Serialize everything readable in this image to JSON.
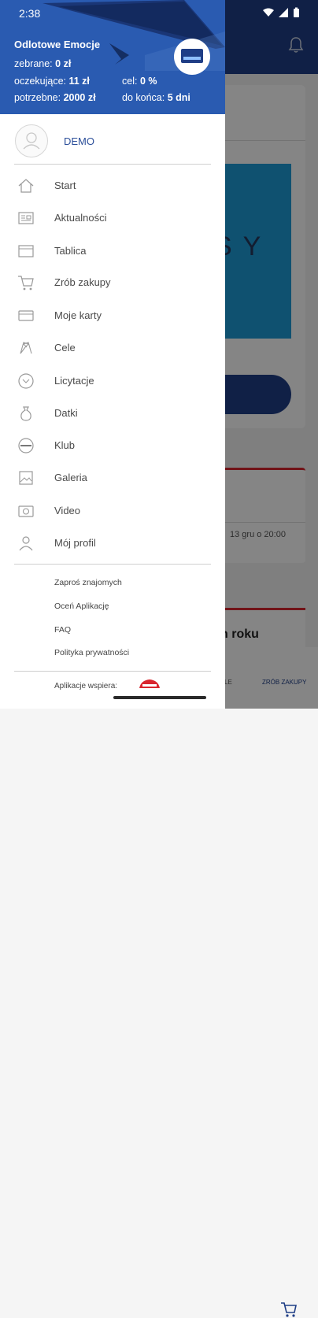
{
  "status_bar": {
    "time": "2:38"
  },
  "header": {
    "title": "Odlotowe Emocje",
    "collected_label": "zebrane:",
    "collected_value": "0 zł",
    "pending_label": "oczekujące:",
    "pending_value": "11 zł",
    "needed_label": "potrzebne:",
    "needed_value": "2000 zł",
    "goal_label": "cel:",
    "goal_value": "0 %",
    "remaining_label": "do końca:",
    "remaining_value": "5 dni"
  },
  "user": {
    "name": "DEMO"
  },
  "menu": [
    {
      "label": "Start",
      "icon": "home-icon"
    },
    {
      "label": "Aktualności",
      "icon": "newspaper-icon"
    },
    {
      "label": "Tablica",
      "icon": "board-icon"
    },
    {
      "label": "Zrób zakupy",
      "icon": "cart-icon"
    },
    {
      "label": "Moje karty",
      "icon": "card-icon"
    },
    {
      "label": "Cele",
      "icon": "flags-icon"
    },
    {
      "label": "Licytacje",
      "icon": "auction-icon"
    },
    {
      "label": "Datki",
      "icon": "money-bag-icon"
    },
    {
      "label": "Klub",
      "icon": "club-icon"
    },
    {
      "label": "Galeria",
      "icon": "gallery-icon"
    },
    {
      "label": "Video",
      "icon": "camera-icon"
    },
    {
      "label": "Mój profil",
      "icon": "profile-icon"
    }
  ],
  "secondary": [
    {
      "label": "Zaproś znajomych"
    },
    {
      "label": "Oceń Aplikację"
    },
    {
      "label": "FAQ"
    },
    {
      "label": "Polityka prywatności"
    }
  ],
  "footer": {
    "support_label": "Aplikacje wspiera:"
  },
  "background": {
    "banner_text": "SY",
    "event_date": "13 gru o 20:00",
    "heading_fragment": "n roku",
    "tab_shopping": "ZRÓB ZAKUPY",
    "tab_partial": "LE"
  },
  "colors": {
    "header_blue": "#2a5bb1",
    "navy": "#1f3e86",
    "accent_red": "#d9262e"
  }
}
